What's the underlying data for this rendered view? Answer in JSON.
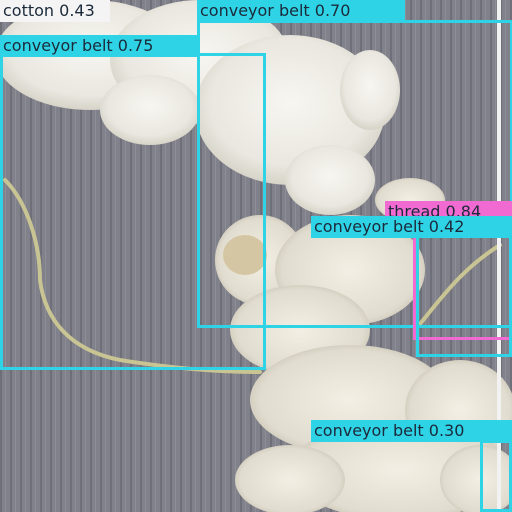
{
  "detections": [
    {
      "label": "cotton 0.43",
      "color": "#f4f4f4"
    },
    {
      "label": "conveyor belt 0.70",
      "color": "#2ed3e6"
    },
    {
      "label": "conveyor belt 0.75",
      "color": "#2ed3e6"
    },
    {
      "label": "thread 0.84",
      "color": "#f06ad2"
    },
    {
      "label": "conveyor belt 0.42",
      "color": "#2ed3e6"
    },
    {
      "label": "conveyor belt 0.30",
      "color": "#2ed3e6"
    }
  ]
}
